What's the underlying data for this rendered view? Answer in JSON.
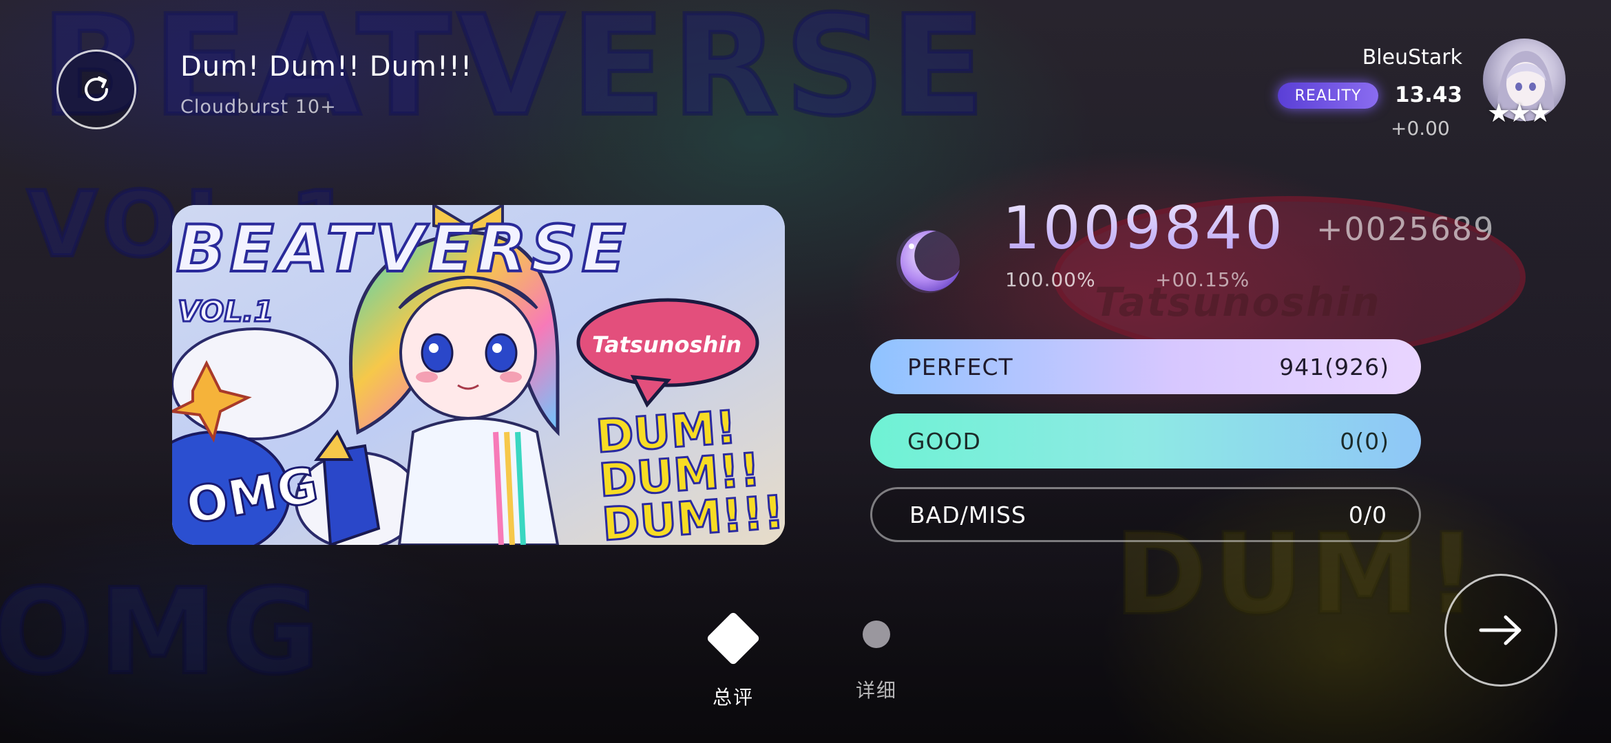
{
  "header": {
    "song_title": "Dum! Dum!! Dum!!!",
    "difficulty": "Cloudburst 10+",
    "player_name": "BleuStark",
    "rank_label": "REALITY",
    "rks": "13.43",
    "rks_delta": "+0.00",
    "stars": "★★★"
  },
  "art": {
    "series_title": "BEATVERSE",
    "volume": "VOL.1",
    "artist_tag": "Tatsunoshin",
    "song_lines": [
      "DUM!",
      "DUM!!",
      "DUM!!!"
    ],
    "omg": "OMG"
  },
  "result": {
    "score": "1009840",
    "score_delta": "+0025689",
    "accuracy": "100.00%",
    "accuracy_delta": "+00.15%",
    "judgements": [
      {
        "label": "PERFECT",
        "value": "941(926)"
      },
      {
        "label": "GOOD",
        "value": "0(0)"
      },
      {
        "label": "BAD/MISS",
        "value": "0/0"
      }
    ]
  },
  "nav": {
    "tabs": [
      {
        "label": "总评"
      },
      {
        "label": "详细"
      }
    ]
  },
  "colors": {
    "perfect": "#d7c7ff",
    "good": "#6ff2d4",
    "rank_pill": "#6a50e0",
    "score": "#c9b5ff"
  },
  "icons": [
    "retry-icon",
    "moon-icon",
    "arrow-right-icon",
    "star-icon",
    "diamond-icon"
  ]
}
